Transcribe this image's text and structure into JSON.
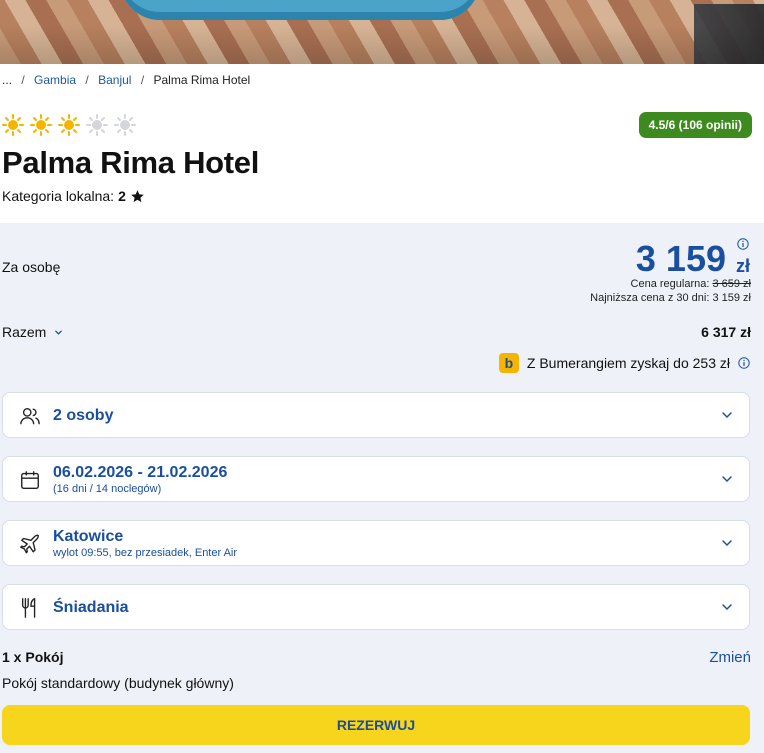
{
  "breadcrumb": {
    "ellipsis": "...",
    "items": [
      "Gambia",
      "Banjul"
    ],
    "current": "Palma Rima Hotel"
  },
  "hotel": {
    "suns_total": 5,
    "suns_filled": 3,
    "rating": "4.5/6 (106 opinii)",
    "name": "Palma Rima Hotel",
    "category_label": "Kategoria lokalna:",
    "category_value": "2"
  },
  "pricing": {
    "per_person_label": "Za osobę",
    "price": "3 159",
    "currency": "zł",
    "regular_label": "Cena regularna:",
    "regular_price": "3 659 zł",
    "lowest_label": "Najniższa cena z 30 dni:",
    "lowest_price": "3 159 zł",
    "total_label": "Razem",
    "total_value": "6 317 zł",
    "bumerang_text": "Z Bumerangiem zyskaj do 253 zł",
    "bumerang_logo": "b"
  },
  "options": {
    "persons": {
      "label": "2 osoby",
      "icon": "users-icon"
    },
    "dates": {
      "label": "06.02.2026 - 21.02.2026",
      "sub": "(16 dni / 14 noclegów)",
      "icon": "calendar-icon"
    },
    "flight": {
      "label": "Katowice",
      "sub": "wylot 09:55, bez przesiadek, Enter Air",
      "icon": "plane-icon"
    },
    "board": {
      "label": "Śniadania",
      "icon": "cutlery-icon"
    }
  },
  "room": {
    "title": "1 x Pokój",
    "change_label": "Zmień",
    "description": "Pokój standardowy (budynek główny)"
  },
  "actions": {
    "reserve_label": "REZERWUJ"
  },
  "colors": {
    "accent": "#1a4fa0",
    "rating_bg": "#3d8b1f",
    "reserve_bg": "#f7d51c",
    "sun": "#f5b400",
    "panel_bg": "#eef2f8"
  }
}
